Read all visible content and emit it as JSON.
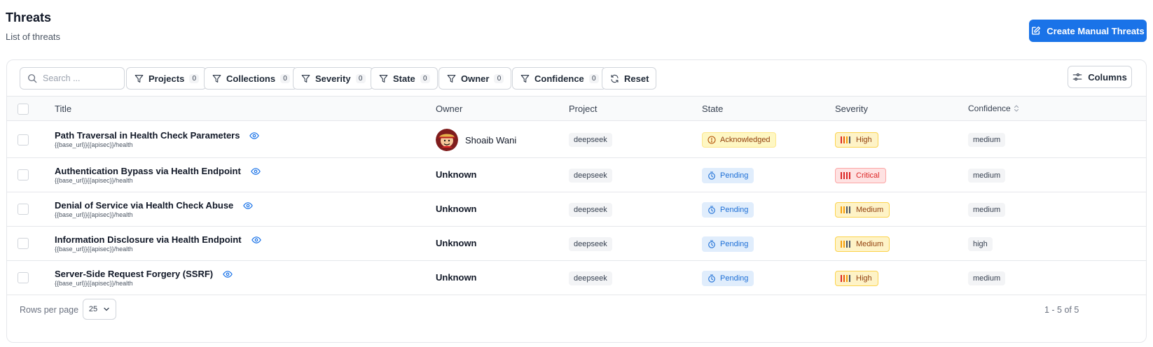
{
  "header": {
    "title": "Threats",
    "subtitle": "List of threats",
    "create_label": "Create Manual Threats"
  },
  "toolbar": {
    "search_placeholder": "Search ...",
    "filters": [
      {
        "label": "Projects",
        "count": "0"
      },
      {
        "label": "Collections",
        "count": "0"
      },
      {
        "label": "Severity",
        "count": "0"
      },
      {
        "label": "State",
        "count": "0"
      },
      {
        "label": "Owner",
        "count": "0"
      },
      {
        "label": "Confidence",
        "count": "0"
      }
    ],
    "reset_label": "Reset",
    "columns_label": "Columns"
  },
  "table": {
    "headers": {
      "title": "Title",
      "owner": "Owner",
      "project": "Project",
      "state": "State",
      "severity": "Severity",
      "confidence": "Confidence"
    },
    "rows": [
      {
        "title": "Path Traversal in Health Check Parameters",
        "endpoint": "{{base_url}}{{apisec}}/health",
        "owner": "Shoaib Wani",
        "project": "deepseek",
        "state": "Acknowledged",
        "severity": "High",
        "confidence": "medium"
      },
      {
        "title": "Authentication Bypass via Health Endpoint",
        "endpoint": "{{base_url}}{{apisec}}/health",
        "owner": "Unknown",
        "project": "deepseek",
        "state": "Pending",
        "severity": "Critical",
        "confidence": "medium"
      },
      {
        "title": "Denial of Service via Health Check Abuse",
        "endpoint": "{{base_url}}{{apisec}}/health",
        "owner": "Unknown",
        "project": "deepseek",
        "state": "Pending",
        "severity": "Medium",
        "confidence": "medium"
      },
      {
        "title": "Information Disclosure via Health Endpoint",
        "endpoint": "{{base_url}}{{apisec}}/health",
        "owner": "Unknown",
        "project": "deepseek",
        "state": "Pending",
        "severity": "Medium",
        "confidence": "high"
      },
      {
        "title": "Server-Side Request Forgery (SSRF)",
        "endpoint": "{{base_url}}{{apisec}}/health",
        "owner": "Unknown",
        "project": "deepseek",
        "state": "Pending",
        "severity": "High",
        "confidence": "medium"
      }
    ]
  },
  "footer": {
    "rows_per_page_label": "Rows per page",
    "rows_per_page_value": "25",
    "pagination": "1 - 5 of 5"
  },
  "colors": {
    "primary": "#1a73e8",
    "pending": "#1d6fd6",
    "acknowledged": "#92400e",
    "critical": "#dc2626",
    "high": "#f59e0b"
  }
}
